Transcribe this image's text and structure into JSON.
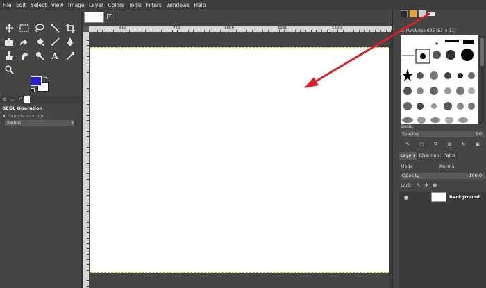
{
  "menu": [
    "File",
    "Edit",
    "Select",
    "View",
    "Image",
    "Layer",
    "Colors",
    "Tools",
    "Filters",
    "Windows",
    "Help"
  ],
  "tool_options": {
    "title": "GEGL Operation",
    "sample_average": "Sample average",
    "radius_label": "Radius",
    "radius_value": "3"
  },
  "ruler": {
    "labels": [
      "500",
      "750",
      "1000",
      "1250",
      "1500"
    ]
  },
  "brushes": {
    "title": "2. Hardness 025 (51 × 51)",
    "preset": "Basic,",
    "spacing_label": "Spacing",
    "spacing_value": "5.0"
  },
  "layers": {
    "tabs": [
      "Layers",
      "Channels",
      "Paths"
    ],
    "mode_label": "Mode",
    "mode_value": "Normal",
    "opacity_label": "Opacity",
    "opacity_value": "100.0",
    "lock_label": "Lock:",
    "layer_name": "Background"
  },
  "colors": {
    "foreground": "#2a1fd2",
    "background": "#ffffff",
    "annotation_arrow": "#d9202a"
  },
  "icons": {
    "tools_row1": [
      "move-icon",
      "rect-select-icon",
      "lasso-icon",
      "fuzzy-select-icon",
      "crop-icon"
    ],
    "tools_row2": [
      "unified-transform-icon",
      "warp-icon",
      "bucket-fill-icon",
      "paintbrush-icon",
      "ink-icon"
    ],
    "tools_row3": [
      "clone-icon",
      "smudge-icon",
      "dodge-icon",
      "text-icon",
      "color-picker-icon"
    ],
    "tools_row4": [
      "zoom-icon"
    ]
  }
}
